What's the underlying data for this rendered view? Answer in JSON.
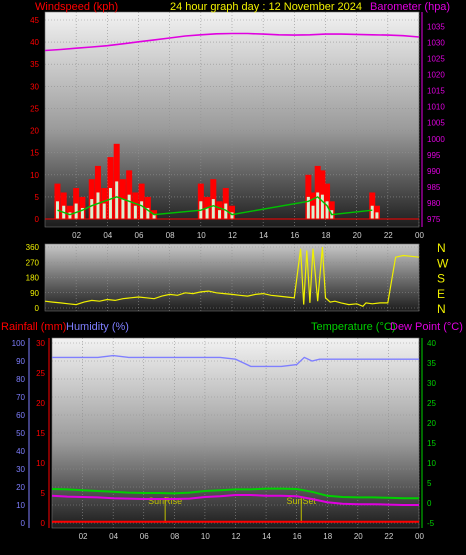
{
  "header": {
    "left_label": "Windspeed (kph)",
    "center_label": "24 hour graph day : 12 November 2024",
    "right_label": "Barometer (hpa)"
  },
  "mid_header": {
    "rain_label": "Rainfall (mm)",
    "humidity_label": "Humidity (%)",
    "temp_label": "Temperature (°C)",
    "dew_label": "Dew Point (°C)"
  },
  "colors": {
    "wind": "#ff0000",
    "gust_fill": "#d8f0d0",
    "wind_avg": "#00c000",
    "barometer": "#e000e0",
    "direction": "#f0f000",
    "humidity": "#7f7fff",
    "temperature": "#00d000",
    "dewpoint": "#e000e0",
    "rainfall": "#ff0000",
    "sun_marker": "#c0c000",
    "grid": "#909090"
  },
  "chart_data": [
    {
      "type": "line",
      "title": "24 hour graph day : 12 November 2024",
      "ylabel": "Windspeed (kph)",
      "ylabel_right": "Barometer (hpa)",
      "x_ticks": [
        "02",
        "04",
        "06",
        "08",
        "10",
        "12",
        "14",
        "16",
        "18",
        "20",
        "22",
        "00"
      ],
      "ylim": [
        0,
        45
      ],
      "y_ticks": [
        0,
        5,
        10,
        15,
        20,
        25,
        30,
        35,
        40,
        45
      ],
      "ylim_right": [
        975,
        1037
      ],
      "y_ticks_right": [
        975,
        980,
        985,
        990,
        995,
        1000,
        1005,
        1010,
        1015,
        1020,
        1025,
        1030,
        1035
      ],
      "series": [
        {
          "name": "Barometer (hpa)",
          "axis": "right",
          "x": [
            0,
            1,
            2,
            3,
            4,
            5,
            6,
            7,
            8,
            9,
            10,
            11,
            12,
            13,
            14,
            15,
            16,
            17,
            18,
            19,
            20,
            21,
            22,
            23,
            24
          ],
          "values": [
            1027.5,
            1027.8,
            1028.2,
            1028.6,
            1029.0,
            1029.6,
            1030.2,
            1030.8,
            1031.4,
            1032.0,
            1032.4,
            1032.7,
            1032.8,
            1032.8,
            1032.6,
            1032.4,
            1032.3,
            1032.4,
            1032.6,
            1032.6,
            1032.5,
            1032.4,
            1032.3,
            1032.1,
            1031.7
          ]
        },
        {
          "name": "Gust",
          "x": [
            0.8,
            1.2,
            1.6,
            2.0,
            2.4,
            3.0,
            3.4,
            3.8,
            4.2,
            4.6,
            5.0,
            5.4,
            5.8,
            6.2,
            6.6,
            7.0,
            10.0,
            10.4,
            10.8,
            11.2,
            11.6,
            12.0,
            16.9,
            17.2,
            17.5,
            17.8,
            18.1,
            18.4,
            21.0,
            21.3
          ],
          "values": [
            8,
            6,
            3,
            7,
            5,
            9,
            12,
            7,
            14,
            17,
            9,
            11,
            6,
            8,
            5,
            2,
            8,
            5,
            9,
            4,
            7,
            3,
            10,
            6,
            12,
            11,
            8,
            4,
            6,
            3
          ]
        },
        {
          "name": "Average",
          "x": [
            0.8,
            1.6,
            2.4,
            3.0,
            3.8,
            4.6,
            5.4,
            6.2,
            7.0,
            10.0,
            10.8,
            11.6,
            12.0,
            16.9,
            17.5,
            18.1,
            18.4,
            21.0
          ],
          "values": [
            2,
            1,
            2,
            3,
            4,
            5,
            4,
            3,
            1,
            2,
            3,
            2,
            1,
            4,
            5,
            3,
            1,
            2
          ]
        }
      ]
    },
    {
      "type": "line",
      "ylim": [
        0,
        360
      ],
      "y_ticks": [
        0,
        90,
        180,
        270,
        360
      ],
      "y_tick_labels": [
        "0",
        "90",
        "180",
        "270",
        "360"
      ],
      "compass_labels": [
        "N",
        "W",
        "S",
        "E",
        "N"
      ],
      "series": [
        {
          "name": "Wind direction",
          "x": [
            0,
            0.5,
            1,
            1.5,
            2,
            2.5,
            3,
            3.5,
            4,
            4.5,
            5,
            5.5,
            6,
            6.5,
            7,
            7.5,
            8,
            8.5,
            9,
            9.5,
            10,
            10.5,
            11,
            11.5,
            12,
            12.5,
            13,
            13.5,
            14,
            14.5,
            15,
            15.5,
            16,
            16.4,
            16.6,
            16.8,
            17.0,
            17.2,
            17.5,
            17.8,
            18.0,
            18.3,
            18.6,
            19.0,
            19.5,
            20,
            20.4,
            20.6,
            21,
            21.5,
            22,
            22.5,
            23,
            23.5,
            24
          ],
          "values": [
            40,
            35,
            30,
            25,
            20,
            35,
            45,
            40,
            50,
            45,
            55,
            60,
            65,
            60,
            55,
            70,
            80,
            75,
            90,
            85,
            95,
            100,
            90,
            85,
            80,
            75,
            70,
            80,
            85,
            75,
            70,
            65,
            60,
            350,
            20,
            340,
            30,
            350,
            40,
            360,
            60,
            35,
            40,
            30,
            20,
            25,
            10,
            30,
            25,
            30,
            30,
            300,
            310,
            305,
            300
          ]
        }
      ]
    },
    {
      "type": "line",
      "x_ticks": [
        "02",
        "04",
        "06",
        "08",
        "10",
        "12",
        "14",
        "16",
        "18",
        "20",
        "22",
        "00"
      ],
      "ylabel": "Humidity (%)",
      "ylabel_rain": "Rainfall (mm)",
      "ylabel_right": "Temperature (°C)",
      "ylabel_right2": "Dew Point (°C)",
      "ylim": [
        0,
        100
      ],
      "y_ticks": [
        0,
        10,
        20,
        30,
        40,
        50,
        60,
        70,
        80,
        90,
        100
      ],
      "ylim_rain": [
        0,
        30
      ],
      "y_ticks_rain": [
        0,
        5,
        10,
        15,
        20,
        25,
        30
      ],
      "ylim_right": [
        -5,
        40
      ],
      "y_ticks_right": [
        -5,
        0,
        5,
        10,
        15,
        20,
        25,
        30,
        35,
        40
      ],
      "annotations": [
        {
          "label": "SunRise",
          "x": 7.4
        },
        {
          "label": "SunSet",
          "x": 16.3
        }
      ],
      "series": [
        {
          "name": "Humidity (%)",
          "x": [
            0,
            1,
            2,
            3,
            4,
            5,
            6,
            7,
            8,
            9,
            10,
            11,
            12,
            12.5,
            13,
            14,
            15,
            16,
            16.5,
            17,
            17.5,
            18,
            19,
            20,
            21,
            22,
            23,
            24
          ],
          "values": [
            92,
            92,
            92,
            92,
            93,
            92,
            92,
            92,
            92,
            92,
            92,
            92,
            91,
            89,
            87,
            87,
            87,
            88,
            92,
            90,
            91,
            91,
            91,
            91,
            91,
            91,
            91,
            91
          ]
        },
        {
          "name": "Temperature (°C)",
          "x": [
            0,
            1,
            2,
            3,
            4,
            5,
            6,
            7,
            8,
            9,
            10,
            11,
            12,
            13,
            14,
            15,
            16,
            17,
            18,
            19,
            20,
            21,
            22,
            23,
            24
          ],
          "values": [
            3.5,
            3.4,
            3.2,
            3.0,
            2.8,
            2.6,
            2.5,
            2.5,
            2.4,
            2.6,
            3.0,
            3.2,
            3.4,
            3.4,
            3.6,
            3.6,
            3.5,
            2.8,
            1.8,
            1.5,
            1.4,
            1.4,
            1.3,
            1.2,
            1.2
          ]
        },
        {
          "name": "Dew Point (°C)",
          "x": [
            0,
            1,
            2,
            3,
            4,
            5,
            6,
            7,
            8,
            9,
            10,
            11,
            12,
            13,
            14,
            15,
            16,
            17,
            18,
            19,
            20,
            21,
            22,
            23,
            24
          ],
          "values": [
            1.8,
            1.6,
            1.5,
            1.4,
            1.2,
            1.1,
            1.0,
            1.0,
            1.0,
            1.1,
            1.5,
            1.7,
            2.0,
            2.0,
            1.8,
            1.8,
            1.7,
            1.0,
            0.2,
            -0.2,
            -0.3,
            -0.3,
            -0.4,
            -0.5,
            -0.5
          ]
        },
        {
          "name": "Rainfall (mm)",
          "x": [
            0,
            24
          ],
          "values": [
            0.2,
            0.2
          ]
        }
      ]
    }
  ]
}
